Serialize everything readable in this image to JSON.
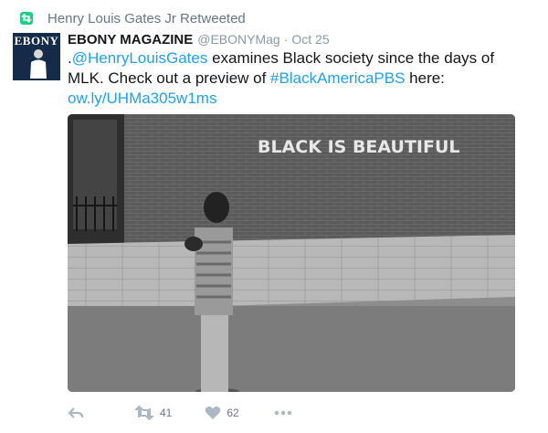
{
  "retweet_context": {
    "label": "Henry Louis Gates Jr Retweeted"
  },
  "avatar": {
    "logo_text": "EBONY"
  },
  "tweet": {
    "display_name": "EBONY MAGAZINE",
    "handle": "@EBONYMag",
    "separator": "·",
    "date": "Oct 25",
    "text_parts": {
      "prefix": ".",
      "mention": "@HenryLouisGates",
      "body": " examines Black society since the days of MLK. Check out a preview of ",
      "hashtag": "#BlackAmericaPBS",
      "after_hashtag": " here:",
      "link": "ow.ly/UHMa305w1ms"
    },
    "media": {
      "wall_text": "BLACK IS BEAUTIFUL"
    }
  },
  "actions": {
    "retweet_count": "41",
    "like_count": "62"
  },
  "colors": {
    "link": "#1da1f2",
    "retweet_green": "#19cf86",
    "muted": "#657786",
    "action_icon": "#aab8c2"
  },
  "icons": [
    "retweet-badge-icon",
    "reply-icon",
    "retweet-icon",
    "like-icon",
    "more-icon"
  ]
}
